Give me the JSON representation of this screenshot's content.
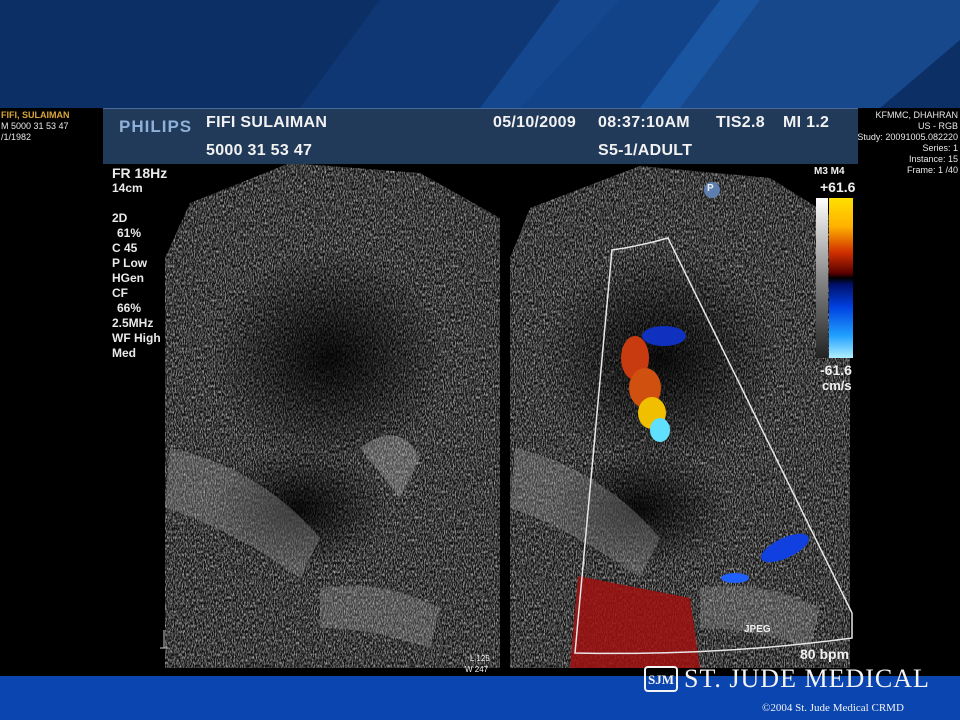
{
  "left_side": {
    "lines": [
      "FIFI, SULAIMAN",
      "M 5000  31 53 47",
      "/1/1982"
    ]
  },
  "right_side": {
    "lines": [
      "KFMMC, DHAHRAN",
      "US - RGB",
      "Study: 20091005.082220",
      "Series: 1",
      "Instance: 15",
      "Frame: 1 /40"
    ]
  },
  "header": {
    "brand": "PHILIPS",
    "patient_name": "FIFI SULAIMAN",
    "patient_id": "5000  31 53 47",
    "date": "05/10/2009",
    "time": "08:37:10AM",
    "tis": "TIS2.8",
    "mi": "MI 1.2",
    "probe": "S5-1/ADULT"
  },
  "params": {
    "fr": "FR 18Hz",
    "depth": "14cm",
    "mode_2d": "2D",
    "gain_2d": "61%",
    "compress": "C 45",
    "power": "P Low",
    "harmonic": "HGen",
    "mode_cf": "CF",
    "gain_cf": "66%",
    "freq": "2.5MHz",
    "wall_filter": "WF High",
    "speed": "Med"
  },
  "colorbar": {
    "map": "M3 M4",
    "max": "+61.6",
    "min": "-61.6",
    "unit": "cm/s",
    "colors": {
      "positive_top": "#ffe000",
      "positive_mid": "#d03000",
      "negative_mid": "#0040e0",
      "negative_bottom": "#b0f0ff"
    }
  },
  "markers": {
    "orientation": "P",
    "jpeg": "JPEG",
    "heart_rate": "80 bpm",
    "l_value": "L 125",
    "w_value": "W 247"
  },
  "footer": {
    "brand": "ST. JUDE MEDICAL",
    "copyright": "©2004 St. Jude Medical CRMD"
  }
}
